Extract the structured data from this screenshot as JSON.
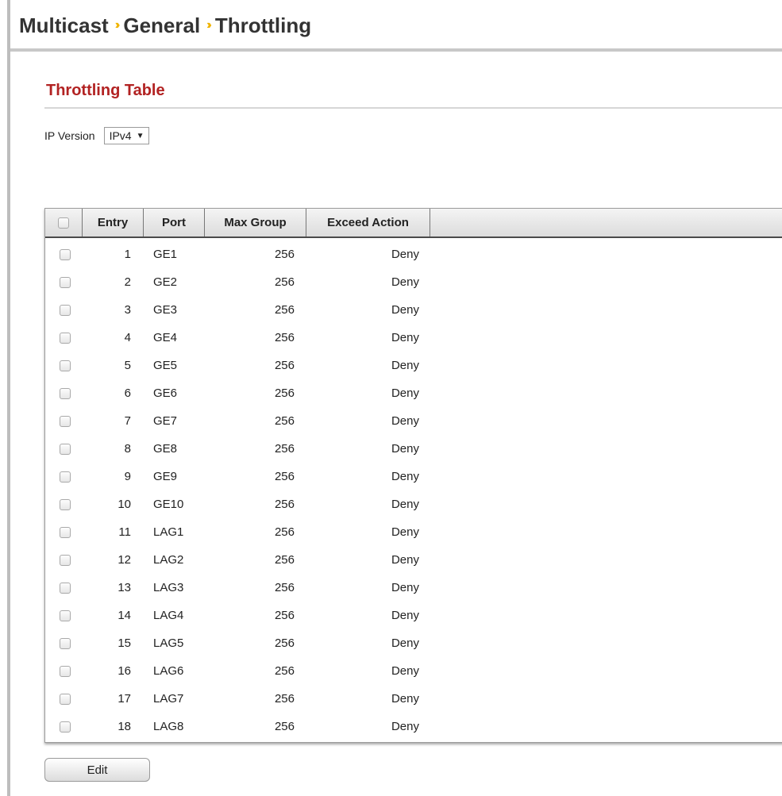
{
  "breadcrumb": {
    "items": [
      "Multicast",
      "General",
      "Throttling"
    ],
    "separator": "››"
  },
  "section": {
    "title": "Throttling Table"
  },
  "ip_version": {
    "label": "IP Version",
    "selected": "IPv4"
  },
  "table": {
    "headers": {
      "entry": "Entry",
      "port": "Port",
      "max_group": "Max Group",
      "exceed_action": "Exceed Action"
    },
    "rows": [
      {
        "entry": "1",
        "port": "GE1",
        "max_group": "256",
        "exceed_action": "Deny"
      },
      {
        "entry": "2",
        "port": "GE2",
        "max_group": "256",
        "exceed_action": "Deny"
      },
      {
        "entry": "3",
        "port": "GE3",
        "max_group": "256",
        "exceed_action": "Deny"
      },
      {
        "entry": "4",
        "port": "GE4",
        "max_group": "256",
        "exceed_action": "Deny"
      },
      {
        "entry": "5",
        "port": "GE5",
        "max_group": "256",
        "exceed_action": "Deny"
      },
      {
        "entry": "6",
        "port": "GE6",
        "max_group": "256",
        "exceed_action": "Deny"
      },
      {
        "entry": "7",
        "port": "GE7",
        "max_group": "256",
        "exceed_action": "Deny"
      },
      {
        "entry": "8",
        "port": "GE8",
        "max_group": "256",
        "exceed_action": "Deny"
      },
      {
        "entry": "9",
        "port": "GE9",
        "max_group": "256",
        "exceed_action": "Deny"
      },
      {
        "entry": "10",
        "port": "GE10",
        "max_group": "256",
        "exceed_action": "Deny"
      },
      {
        "entry": "11",
        "port": "LAG1",
        "max_group": "256",
        "exceed_action": "Deny"
      },
      {
        "entry": "12",
        "port": "LAG2",
        "max_group": "256",
        "exceed_action": "Deny"
      },
      {
        "entry": "13",
        "port": "LAG3",
        "max_group": "256",
        "exceed_action": "Deny"
      },
      {
        "entry": "14",
        "port": "LAG4",
        "max_group": "256",
        "exceed_action": "Deny"
      },
      {
        "entry": "15",
        "port": "LAG5",
        "max_group": "256",
        "exceed_action": "Deny"
      },
      {
        "entry": "16",
        "port": "LAG6",
        "max_group": "256",
        "exceed_action": "Deny"
      },
      {
        "entry": "17",
        "port": "LAG7",
        "max_group": "256",
        "exceed_action": "Deny"
      },
      {
        "entry": "18",
        "port": "LAG8",
        "max_group": "256",
        "exceed_action": "Deny"
      }
    ]
  },
  "actions": {
    "edit_label": "Edit"
  },
  "colors": {
    "section_title": "#b22222",
    "separator": "#f0b400"
  }
}
